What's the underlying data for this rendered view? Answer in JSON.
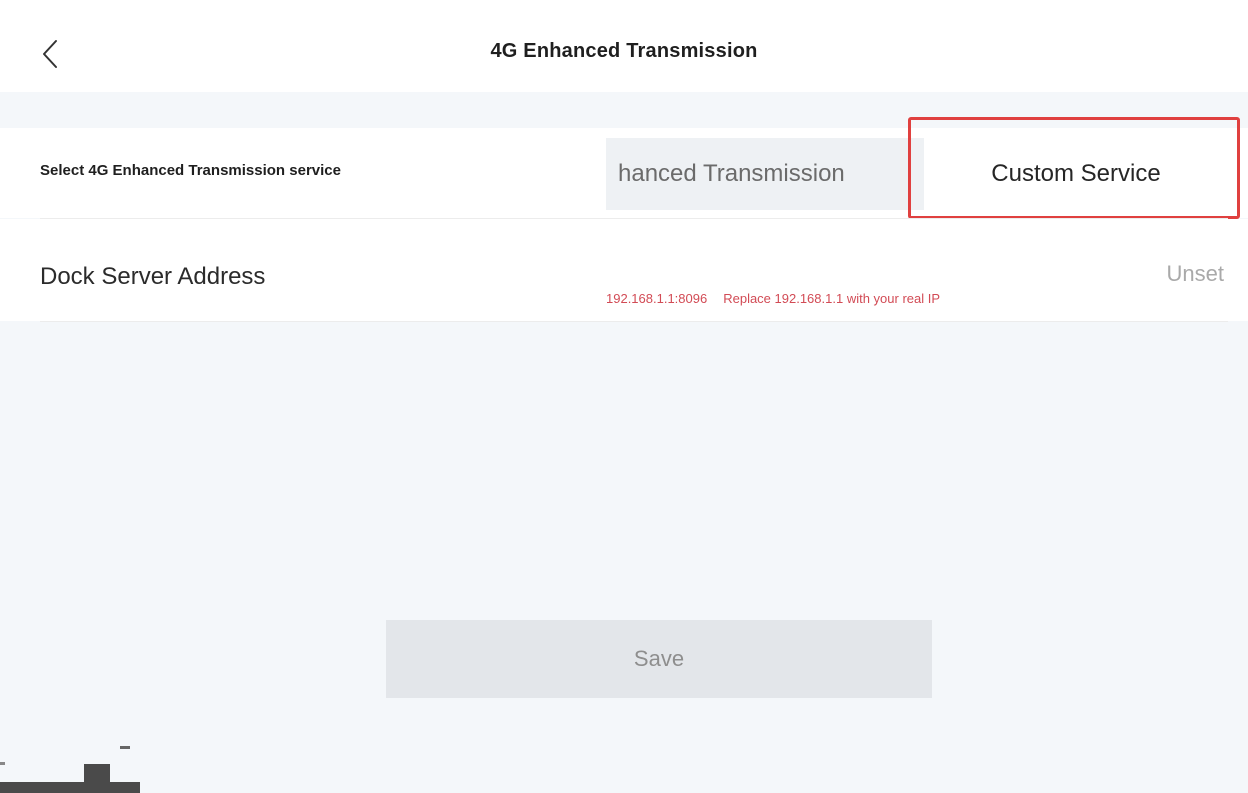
{
  "header": {
    "title": "4G Enhanced Transmission",
    "back_icon": "chevron-left-icon"
  },
  "service_row": {
    "label": "Select 4G Enhanced Transmission service",
    "options": [
      {
        "label": "hanced Transmission",
        "selected": false
      },
      {
        "label": "Custom Service",
        "selected": true
      }
    ],
    "highlight_color": "#e0403f"
  },
  "server_row": {
    "label": "Dock Server Address",
    "value": "Unset",
    "annotation_address": "192.168.1.1:8096",
    "annotation_hint": "Replace 192.168.1.1 with your real IP",
    "annotation_color": "#d24b55"
  },
  "footer": {
    "save_label": "Save"
  }
}
